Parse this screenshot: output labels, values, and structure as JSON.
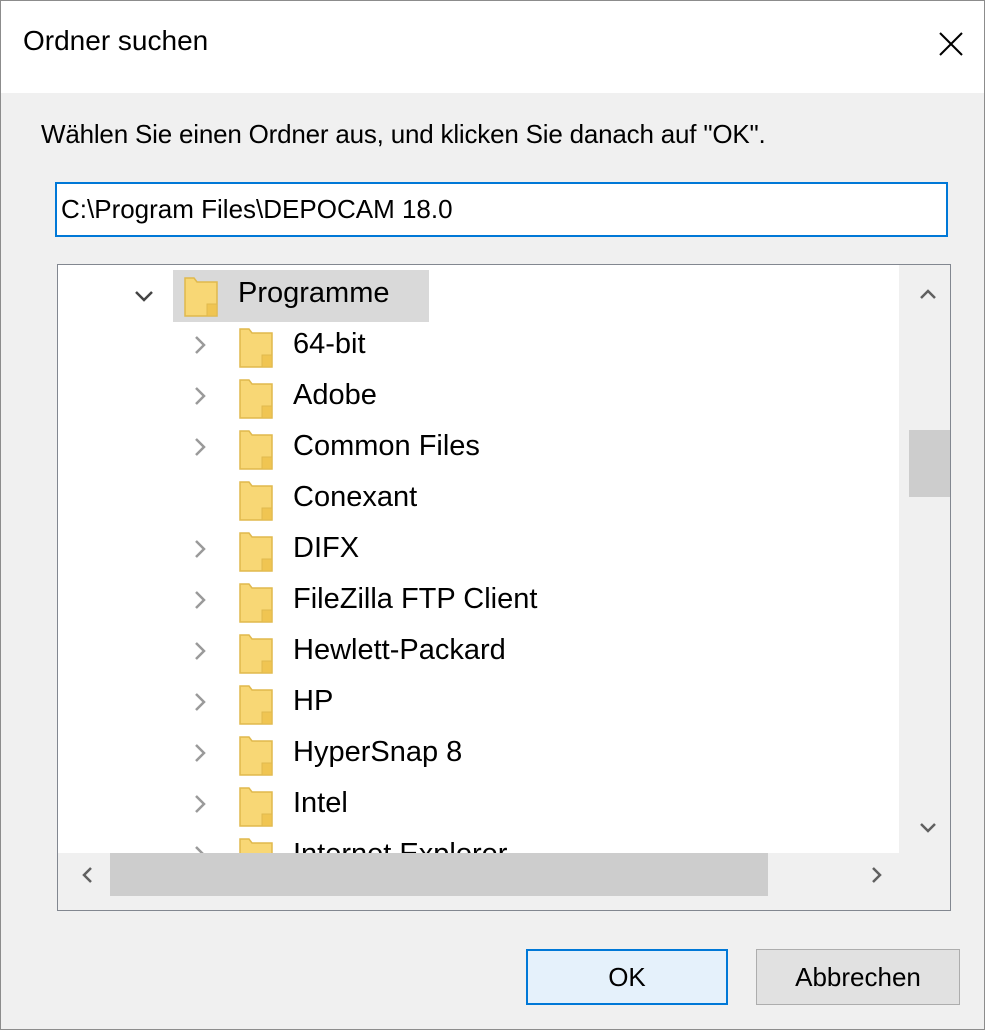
{
  "window": {
    "title": "Ordner suchen",
    "close_icon": "close-icon"
  },
  "instruction": "Wählen Sie einen Ordner aus, und klicken Sie danach auf \"OK\".",
  "path_input": {
    "value": "C:\\Program Files\\DEPOCAM 18.0"
  },
  "tree": {
    "root": {
      "label": "Programme",
      "expanded": true,
      "selected": true
    },
    "items": [
      {
        "label": "64-bit",
        "has_children": true
      },
      {
        "label": "Adobe",
        "has_children": true
      },
      {
        "label": "Common Files",
        "has_children": true
      },
      {
        "label": "Conexant",
        "has_children": false
      },
      {
        "label": "DIFX",
        "has_children": true
      },
      {
        "label": "FileZilla FTP Client",
        "has_children": true
      },
      {
        "label": "Hewlett-Packard",
        "has_children": true
      },
      {
        "label": "HP",
        "has_children": true
      },
      {
        "label": "HyperSnap 8",
        "has_children": true
      },
      {
        "label": "Intel",
        "has_children": true
      },
      {
        "label": "Internet Explorer",
        "has_children": true
      }
    ]
  },
  "buttons": {
    "ok": "OK",
    "cancel": "Abbrechen"
  },
  "colors": {
    "accent": "#0078d7",
    "folder": "#f8d775",
    "selection": "#d9d9d9"
  }
}
